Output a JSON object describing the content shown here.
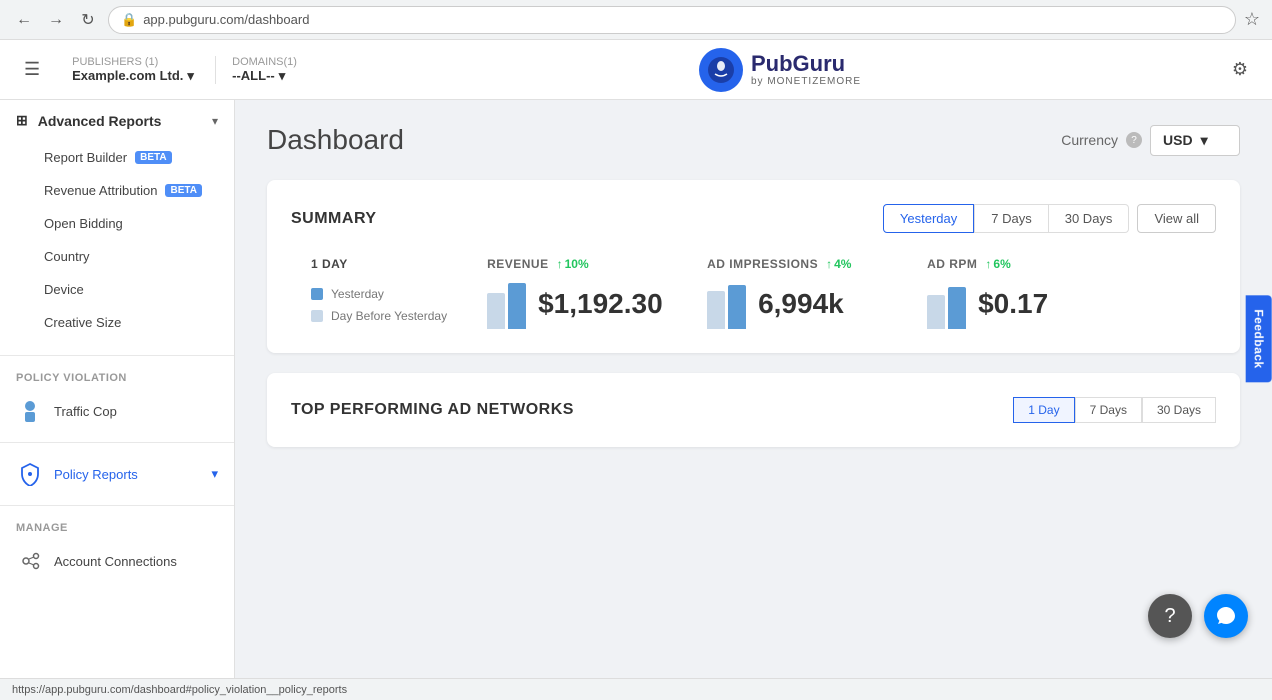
{
  "browser": {
    "url": "app.pubguru.com/dashboard",
    "back_btn": "←",
    "forward_btn": "→",
    "refresh_btn": "↻"
  },
  "top_nav": {
    "hamburger": "☰",
    "publishers_label": "PUBLISHERS (1)",
    "publisher_name": "Example.com Ltd.",
    "domains_label": "DOMAINS(1)",
    "domain_value": "--ALL--",
    "logo_title": "PubGuru",
    "logo_subtitle": "by MONETIZEMORE",
    "settings_icon": "⚙"
  },
  "sidebar": {
    "advanced_reports_label": "Advanced Reports",
    "items": [
      {
        "label": "Report Builder",
        "badge": "BETA"
      },
      {
        "label": "Revenue Attribution",
        "badge": "BETA"
      },
      {
        "label": "Open Bidding",
        "badge": ""
      },
      {
        "label": "Country",
        "badge": ""
      },
      {
        "label": "Device",
        "badge": ""
      },
      {
        "label": "Creative Size",
        "badge": ""
      }
    ],
    "policy_violation_label": "POLICY VIOLATION",
    "traffic_cop_label": "Traffic Cop",
    "policy_reports_label": "Policy Reports",
    "manage_label": "MANAGE",
    "account_connections_label": "Account Connections"
  },
  "dashboard": {
    "title": "Dashboard",
    "currency_label": "Currency",
    "currency_value": "USD",
    "summary_title": "SUMMARY",
    "time_buttons": [
      "Yesterday",
      "7 Days",
      "30 Days"
    ],
    "view_all": "View all",
    "period_label": "1 DAY",
    "legend": {
      "yesterday": "Yesterday",
      "day_before": "Day Before Yesterday"
    },
    "metrics": [
      {
        "label": "REVENUE",
        "change": "↑ 10%",
        "change_dir": "up",
        "value": "$1,192.30",
        "bar_prev_height": 36,
        "bar_curr_height": 46
      },
      {
        "label": "AD IMPRESSIONS",
        "change": "↑ 4%",
        "change_dir": "up",
        "value": "6,994k",
        "bar_prev_height": 38,
        "bar_curr_height": 44
      },
      {
        "label": "AD RPM",
        "change": "↑ 6%",
        "change_dir": "up",
        "value": "$0.17",
        "bar_prev_height": 34,
        "bar_curr_height": 42
      }
    ],
    "top_section_title": "TOP PERFORMING AD NETWORKS",
    "top_time_buttons": [
      "1 Day",
      "7 Days",
      "30 Days"
    ]
  },
  "bottom_bar": {
    "url": "https://app.pubguru.com/dashboard#policy_violation__policy_reports"
  },
  "feedback_tab": "Feedback"
}
